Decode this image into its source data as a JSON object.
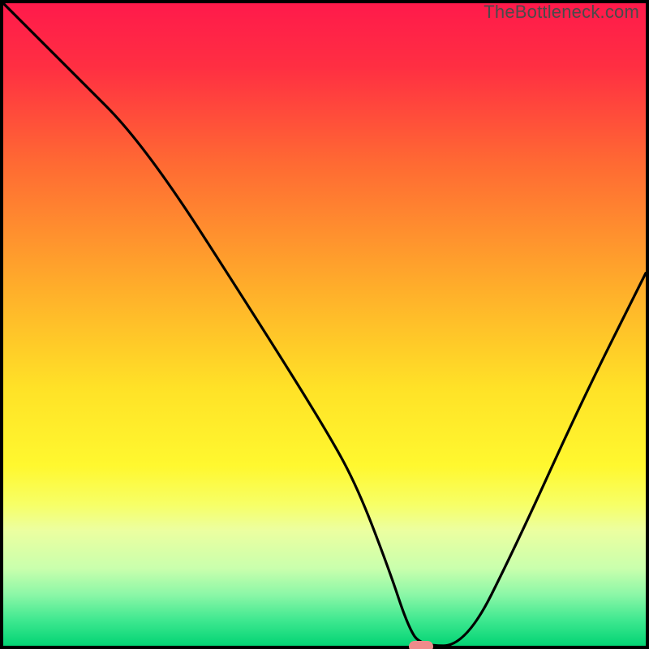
{
  "watermark": "TheBottleneck.com",
  "chart_data": {
    "type": "line",
    "title": "",
    "xlabel": "",
    "ylabel": "",
    "xlim": [
      0,
      100
    ],
    "ylim": [
      0,
      100
    ],
    "x": [
      0,
      10,
      22,
      40,
      50,
      55,
      60,
      63,
      65,
      72,
      80,
      90,
      100
    ],
    "values": [
      100,
      90,
      78,
      50,
      34,
      25,
      12,
      3,
      0,
      0,
      16,
      38,
      58
    ],
    "marker": {
      "x": 64.5,
      "y": 0
    },
    "gradient_stops": [
      {
        "pos": 0.0,
        "color": "#ff1a4b"
      },
      {
        "pos": 0.1,
        "color": "#ff2f42"
      },
      {
        "pos": 0.25,
        "color": "#ff6a33"
      },
      {
        "pos": 0.45,
        "color": "#ffb02a"
      },
      {
        "pos": 0.6,
        "color": "#ffe227"
      },
      {
        "pos": 0.72,
        "color": "#fff82f"
      },
      {
        "pos": 0.78,
        "color": "#f7ff66"
      },
      {
        "pos": 0.82,
        "color": "#ecffa0"
      },
      {
        "pos": 0.88,
        "color": "#c9ffad"
      },
      {
        "pos": 0.92,
        "color": "#8cf7a7"
      },
      {
        "pos": 0.96,
        "color": "#3fe890"
      },
      {
        "pos": 1.0,
        "color": "#03d474"
      }
    ]
  }
}
